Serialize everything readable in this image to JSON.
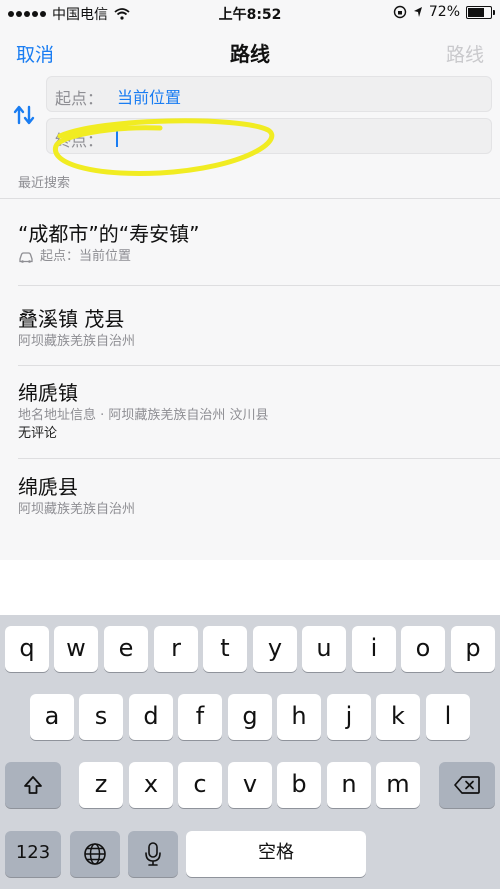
{
  "status_bar": {
    "carrier": "中国电信",
    "time": "上午8:52",
    "battery_percent": "72%",
    "battery_level": 0.72
  },
  "nav": {
    "cancel": "取消",
    "title": "路线",
    "route": "路线"
  },
  "route_form": {
    "start_label": "起点：",
    "start_value": "当前位置",
    "end_label": "终点："
  },
  "recent": {
    "header": "最近搜索",
    "items": [
      {
        "title": "“成都市”的“寿安镇”",
        "subtitle": "起点：当前位置",
        "icon": "car-icon"
      },
      {
        "title": "叠溪镇 茂县",
        "subtitle": "阿坝藏族羌族自治州"
      },
      {
        "title": "绵虒镇",
        "subtitle": "地名地址信息 · 阿坝藏族羌族自治州 汶川县",
        "extra": "无评论"
      },
      {
        "title": "绵虒县",
        "subtitle": "阿坝藏族羌族自治州"
      }
    ]
  },
  "keyboard": {
    "row1": [
      "q",
      "w",
      "e",
      "r",
      "t",
      "y",
      "u",
      "i",
      "o",
      "p"
    ],
    "row2": [
      "a",
      "s",
      "d",
      "f",
      "g",
      "h",
      "j",
      "k",
      "l"
    ],
    "row3": [
      "z",
      "x",
      "c",
      "v",
      "b",
      "n",
      "m"
    ],
    "numbers": "123",
    "space": "空格"
  },
  "colors": {
    "accent": "#1a7df2",
    "highlight": "#f1ec22"
  }
}
